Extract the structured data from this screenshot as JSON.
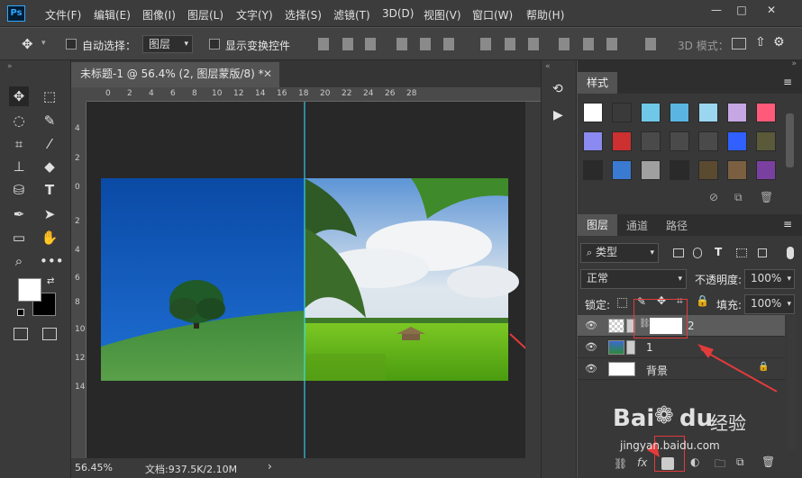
{
  "app": {
    "logo": "Ps"
  },
  "menu": [
    "文件(F)",
    "编辑(E)",
    "图像(I)",
    "图层(L)",
    "文字(Y)",
    "选择(S)",
    "滤镜(T)",
    "3D(D)",
    "视图(V)",
    "窗口(W)",
    "帮助(H)"
  ],
  "window_controls": [
    "—",
    "□",
    "✕"
  ],
  "options": {
    "auto_select_label": "自动选择：",
    "auto_select_value": "图层",
    "show_transform_label": "显示变换控件",
    "mode_3d_label": "3D 模式："
  },
  "document": {
    "tab_title": "未标题-1 @ 56.4% (2, 图层蒙版/8) *",
    "ruler_h_labels": [
      "0",
      "2",
      "4",
      "6",
      "8",
      "10",
      "12",
      "14",
      "16",
      "18",
      "20",
      "22",
      "24",
      "26",
      "28"
    ],
    "ruler_v_labels": [
      "4",
      "2",
      "0",
      "2",
      "4",
      "6",
      "8",
      "10",
      "12",
      "14"
    ],
    "status_zoom": "56.45%",
    "status_doc": "文档:937.5K/2.10M"
  },
  "styles_panel": {
    "tab": "样式",
    "swatch_colors": [
      "#ffffff",
      "#3a3a3a",
      "#6fc8e8",
      "#5ab6e0",
      "#9ad6f0",
      "#c7a6e4",
      "#ff5a7a",
      "#8a8af0",
      "#cc3030",
      "#4a4a4a",
      "#4a4a4a",
      "#4a4a4a",
      "#3060ff",
      "#5a5a3a",
      "#2a2a2a",
      "#3a7ad0",
      "#a0a0a0",
      "#2a2a2a",
      "#5a4a30",
      "#7a6040",
      "#7a40a0"
    ]
  },
  "layers_panel": {
    "tabs": [
      "图层",
      "通道",
      "路径"
    ],
    "filter_label": "类型",
    "blend_mode": "正常",
    "opacity_label": "不透明度:",
    "opacity_value": "100%",
    "lock_label": "锁定:",
    "fill_label": "填充:",
    "fill_value": "100%",
    "layers": [
      {
        "name": "2",
        "selected": true,
        "has_mask": true
      },
      {
        "name": "1",
        "selected": false,
        "has_mask": false
      },
      {
        "name": "背景",
        "selected": false,
        "locked": true
      }
    ],
    "footer_icons": [
      "link-icon",
      "fx-icon",
      "mask-icon",
      "adjustment-icon",
      "group-icon",
      "new-layer-icon",
      "trash-icon"
    ]
  },
  "watermark": {
    "line1": "Bai",
    "du": "du",
    "line1b": "经验",
    "line2": "jingyan.baidu.com"
  },
  "colors": {
    "accent_red": "#e23b3b",
    "guide_cyan": "#3fe6ff",
    "sky_blue": "#0a4fa8"
  }
}
